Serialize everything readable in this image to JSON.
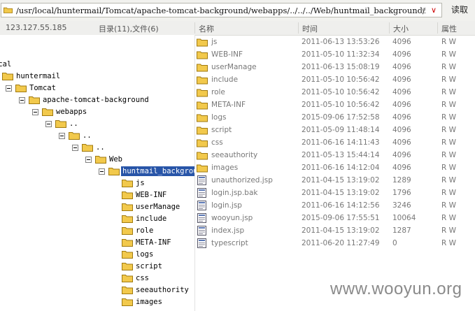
{
  "toolbar": {
    "path": "/usr/local/huntermail/Tomcat/apache-tomcat-background/webapps/../../../Web/huntmail_background/",
    "read_label": "读取",
    "pm_glyph": "±",
    "dropdown_glyph": "∨"
  },
  "header": {
    "ip": "123.127.55.185",
    "summary": "目录(11),文件(6)",
    "col_name": "名称",
    "col_time": "时间",
    "col_size": "大小",
    "col_attr": "属性"
  },
  "tree": [
    {
      "label": "ocal",
      "depth": 0,
      "toggle": false,
      "folder": false
    },
    {
      "label": "huntermail",
      "depth": 0,
      "toggle": false,
      "folder": true
    },
    {
      "label": "Tomcat",
      "depth": 1,
      "toggle": true,
      "folder": true
    },
    {
      "label": "apache-tomcat-background",
      "depth": 2,
      "toggle": true,
      "folder": true
    },
    {
      "label": "webapps",
      "depth": 3,
      "toggle": true,
      "folder": true
    },
    {
      "label": "..",
      "depth": 4,
      "toggle": true,
      "folder": true
    },
    {
      "label": "..",
      "depth": 5,
      "toggle": true,
      "folder": true
    },
    {
      "label": "..",
      "depth": 6,
      "toggle": true,
      "folder": true
    },
    {
      "label": "Web",
      "depth": 7,
      "toggle": true,
      "folder": true
    },
    {
      "label": "huntmail_background",
      "depth": 8,
      "toggle": true,
      "folder": true,
      "selected": true
    },
    {
      "label": "js",
      "depth": 9,
      "toggle": false,
      "folder": true
    },
    {
      "label": "WEB-INF",
      "depth": 9,
      "toggle": false,
      "folder": true
    },
    {
      "label": "userManage",
      "depth": 9,
      "toggle": false,
      "folder": true
    },
    {
      "label": "include",
      "depth": 9,
      "toggle": false,
      "folder": true
    },
    {
      "label": "role",
      "depth": 9,
      "toggle": false,
      "folder": true
    },
    {
      "label": "META-INF",
      "depth": 9,
      "toggle": false,
      "folder": true
    },
    {
      "label": "logs",
      "depth": 9,
      "toggle": false,
      "folder": true
    },
    {
      "label": "script",
      "depth": 9,
      "toggle": false,
      "folder": true
    },
    {
      "label": "css",
      "depth": 9,
      "toggle": false,
      "folder": true
    },
    {
      "label": "seeauthority",
      "depth": 9,
      "toggle": false,
      "folder": true
    },
    {
      "label": "images",
      "depth": 9,
      "toggle": false,
      "folder": true
    }
  ],
  "files": [
    {
      "name": "js",
      "time": "2011-06-13 13:53:26",
      "size": "4096",
      "attr": "R W",
      "type": "folder"
    },
    {
      "name": "WEB-INF",
      "time": "2011-05-10 11:32:34",
      "size": "4096",
      "attr": "R W",
      "type": "folder"
    },
    {
      "name": "userManage",
      "time": "2011-06-13 15:08:19",
      "size": "4096",
      "attr": "R W",
      "type": "folder"
    },
    {
      "name": "include",
      "time": "2011-05-10 10:56:42",
      "size": "4096",
      "attr": "R W",
      "type": "folder"
    },
    {
      "name": "role",
      "time": "2011-05-10 10:56:42",
      "size": "4096",
      "attr": "R W",
      "type": "folder"
    },
    {
      "name": "META-INF",
      "time": "2011-05-10 10:56:42",
      "size": "4096",
      "attr": "R W",
      "type": "folder"
    },
    {
      "name": "logs",
      "time": "2015-09-06 17:52:58",
      "size": "4096",
      "attr": "R W",
      "type": "folder"
    },
    {
      "name": "script",
      "time": "2011-05-09 11:48:14",
      "size": "4096",
      "attr": "R W",
      "type": "folder"
    },
    {
      "name": "css",
      "time": "2011-06-16 14:11:43",
      "size": "4096",
      "attr": "R W",
      "type": "folder"
    },
    {
      "name": "seeauthority",
      "time": "2011-05-13 15:44:14",
      "size": "4096",
      "attr": "R W",
      "type": "folder"
    },
    {
      "name": "images",
      "time": "2011-06-16 14:12:04",
      "size": "4096",
      "attr": "R W",
      "type": "folder"
    },
    {
      "name": "unauthorized.jsp",
      "time": "2011-04-15 13:19:02",
      "size": "1289",
      "attr": "R W",
      "type": "file"
    },
    {
      "name": "login.jsp.bak",
      "time": "2011-04-15 13:19:02",
      "size": "1796",
      "attr": "R W",
      "type": "file"
    },
    {
      "name": "login.jsp",
      "time": "2011-06-16 14:12:56",
      "size": "3246",
      "attr": "R W",
      "type": "file"
    },
    {
      "name": "wooyun.jsp",
      "time": "2015-09-06 17:55:51",
      "size": "10064",
      "attr": "R W",
      "type": "file"
    },
    {
      "name": "index.jsp",
      "time": "2011-04-15 13:19:02",
      "size": "1287",
      "attr": "R W",
      "type": "file"
    },
    {
      "name": "typescript",
      "time": "2011-06-20 11:27:49",
      "size": "0",
      "attr": "R W",
      "type": "file"
    }
  ],
  "watermark": "www.wooyun.org",
  "colors": {
    "folder": "#f2c94c",
    "selection": "#2855a8",
    "dropdown_arrow": "#cc0000"
  }
}
